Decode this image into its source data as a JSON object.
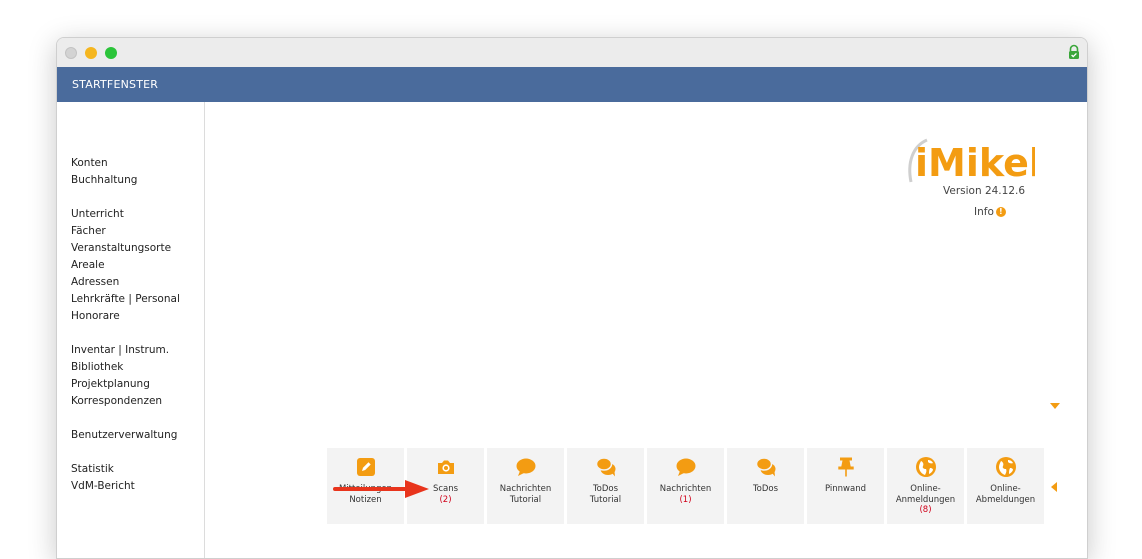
{
  "header": {
    "title": "STARTFENSTER"
  },
  "sidebar": {
    "groups": [
      [
        "Konten",
        "Buchhaltung"
      ],
      [
        "Unterricht",
        "Fächer",
        "Veranstaltungsorte",
        "Areale",
        "Adressen",
        "Lehrkräfte | Personal",
        "Honorare"
      ],
      [
        "Inventar | Instrum.",
        "Bibliothek",
        "Projektplanung",
        "Korrespondenzen"
      ],
      [
        "Benutzerverwaltung"
      ],
      [
        "Statistik",
        "VdM-Bericht"
      ]
    ]
  },
  "logo": {
    "text": "iMikel",
    "version": "Version 24.12.6",
    "info": "Info",
    "info_badge": "!"
  },
  "tiles": [
    {
      "l1": "Mitteilungen",
      "l2": "Notizen",
      "count": "",
      "icon": "edit-icon"
    },
    {
      "l1": "Scans",
      "l2": "",
      "count": "(2)",
      "icon": "camera-icon"
    },
    {
      "l1": "Nachrichten",
      "l2": "Tutorial",
      "count": "",
      "icon": "speech-bubble-icon"
    },
    {
      "l1": "ToDos",
      "l2": "Tutorial",
      "count": "",
      "icon": "chat-bubbles-icon"
    },
    {
      "l1": "Nachrichten",
      "l2": "",
      "count": "(1)",
      "icon": "speech-bubble-icon"
    },
    {
      "l1": "ToDos",
      "l2": "",
      "count": "",
      "icon": "chat-bubbles-icon"
    },
    {
      "l1": "Pinnwand",
      "l2": "",
      "count": "",
      "icon": "pin-icon"
    },
    {
      "l1": "Online-",
      "l2": "Anmeldungen",
      "count": "(8)",
      "icon": "globe-icon"
    },
    {
      "l1": "Online-",
      "l2": "Abmeldungen",
      "count": "",
      "icon": "globe-icon"
    }
  ],
  "colors": {
    "accent": "#f39c12",
    "header": "#4a6b9c",
    "count": "#d0021b",
    "logo": "#f39c12"
  }
}
